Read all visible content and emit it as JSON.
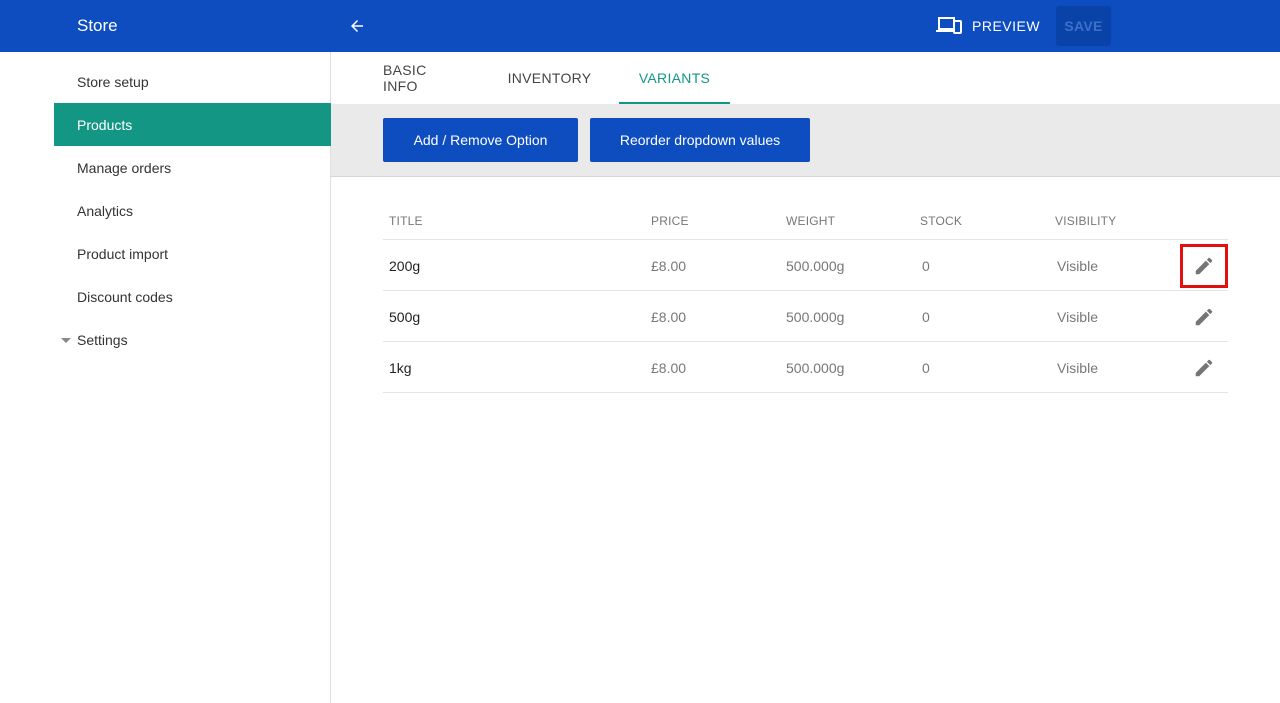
{
  "header": {
    "title": "Store",
    "preview_label": "PREVIEW",
    "save_label": "SAVE"
  },
  "sidebar": {
    "items": [
      {
        "label": "Store setup"
      },
      {
        "label": "Products"
      },
      {
        "label": "Manage orders"
      },
      {
        "label": "Analytics"
      },
      {
        "label": "Product import"
      },
      {
        "label": "Discount codes"
      },
      {
        "label": "Settings"
      }
    ]
  },
  "tabs": [
    {
      "label": "BASIC INFO"
    },
    {
      "label": "INVENTORY"
    },
    {
      "label": "VARIANTS"
    }
  ],
  "toolbar": {
    "add_remove_label": "Add / Remove Option",
    "reorder_label": "Reorder dropdown values"
  },
  "table": {
    "headers": [
      "TITLE",
      "PRICE",
      "WEIGHT",
      "STOCK",
      "VISIBILITY"
    ],
    "rows": [
      {
        "title": "200g",
        "price": "£8.00",
        "weight": "500.000g",
        "stock": "0",
        "visibility": "Visible"
      },
      {
        "title": "500g",
        "price": "£8.00",
        "weight": "500.000g",
        "stock": "0",
        "visibility": "Visible"
      },
      {
        "title": "1kg",
        "price": "£8.00",
        "weight": "500.000g",
        "stock": "0",
        "visibility": "Visible"
      }
    ]
  },
  "colors": {
    "primary": "#0d4dbf",
    "accent": "#139684",
    "highlight": "#e01010"
  },
  "icons": {
    "back": "arrow-left-icon",
    "preview": "devices-icon",
    "edit": "pencil-icon",
    "settings_caret": "caret-down-icon"
  }
}
